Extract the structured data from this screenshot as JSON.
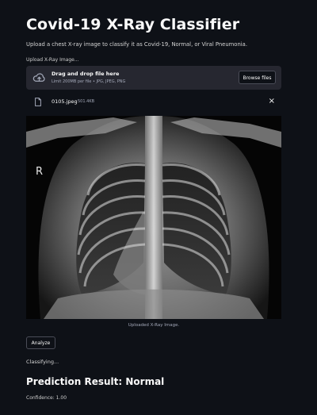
{
  "header": {
    "title": "Covid-19 X-Ray Classifier",
    "description": "Upload a chest X-ray image to classify it as Covid-19, Normal, or Viral Pneumonia."
  },
  "uploader": {
    "label": "Upload X-Ray Image...",
    "drop_title": "Drag and drop file here",
    "drop_subtitle": "Limit 200MB per file • JPG, JPEG, PNG",
    "browse_label": "Browse files",
    "icon": "cloud-upload-icon"
  },
  "uploaded_file": {
    "name": "0105.jpeg",
    "size": "501.4KB",
    "icon": "file-icon",
    "close_symbol": "×"
  },
  "image": {
    "side_marker": "R",
    "caption": "Uploaded X-Ray Image."
  },
  "actions": {
    "analyze_label": "Analyze"
  },
  "status": {
    "text": "Classifying..."
  },
  "result": {
    "heading": "Prediction Result: Normal",
    "confidence": "Confidence: 1.00"
  },
  "colors": {
    "background": "#0e1117",
    "panel": "#262730",
    "text": "#fafafa",
    "muted": "#a3a8b8"
  }
}
